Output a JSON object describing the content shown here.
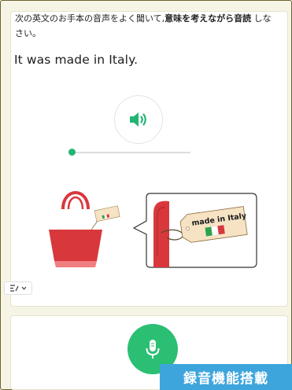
{
  "prompt": {
    "part1": "次の英文のお手本の音声をよく聞いて,",
    "emphasis": "意味を考えながら音読",
    "part2": "しなさい。"
  },
  "sentence": "It was made in Italy.",
  "illustration": {
    "tag_text": "made in Italy"
  },
  "banner": "録音機能搭載",
  "colors": {
    "accent_green": "#22b573",
    "mic_green": "#2bbf73",
    "banner_blue": "#3ea5dc",
    "bag_red": "#d8383c"
  },
  "icons": {
    "audio": "speaker-icon",
    "record": "microphone-icon",
    "voice_menu": "voice-menu-icon"
  }
}
